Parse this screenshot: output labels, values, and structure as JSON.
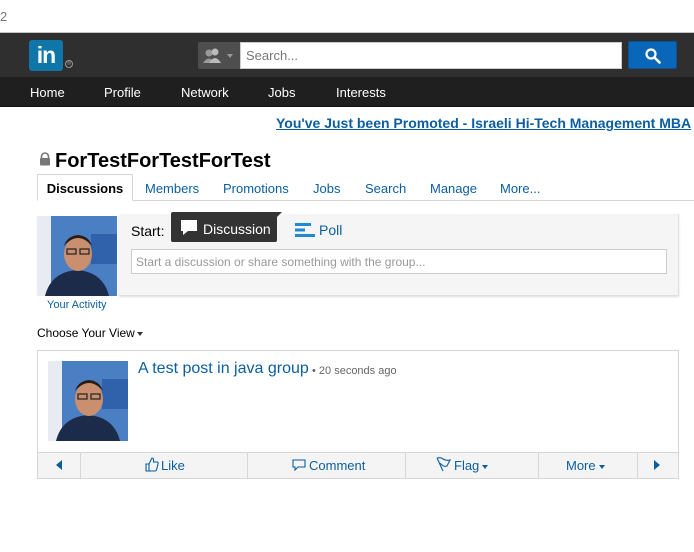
{
  "browser": {
    "url_fragment": "2"
  },
  "header": {
    "logo_text": "in",
    "search_placeholder": "Search...",
    "nav": [
      "Home",
      "Profile",
      "Network",
      "Jobs",
      "Interests"
    ]
  },
  "ad": {
    "text": "You've Just been Promoted - Israeli Hi-Tech Management MBA"
  },
  "group": {
    "title": "ForTestForTestForTest",
    "tabs": [
      "Discussions",
      "Members",
      "Promotions",
      "Jobs",
      "Search",
      "Manage",
      "More..."
    ],
    "active_tab": "Discussions"
  },
  "share": {
    "start_label": "Start:",
    "discussion_label": "Discussion",
    "poll_label": "Poll",
    "input_placeholder": "Start a discussion or share something with the group...",
    "your_activity": "Your Activity"
  },
  "view": {
    "choose_view": "Choose Your View"
  },
  "post": {
    "title": "A test post in java group",
    "time": "• 20 seconds ago",
    "actions": {
      "like": "Like",
      "comment": "Comment",
      "flag": "Flag",
      "more": "More"
    }
  },
  "colors": {
    "brand": "#0e76a8",
    "link": "#0b5e9e",
    "header_bg": "#2f2f2f",
    "nav_bg": "#1f1f1f"
  }
}
